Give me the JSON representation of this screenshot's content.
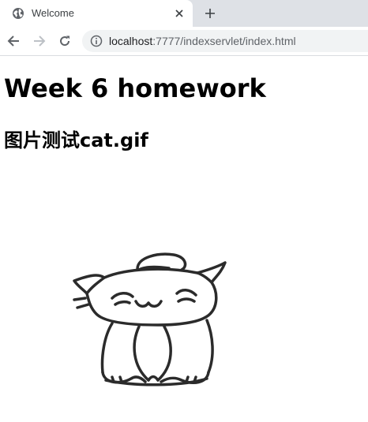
{
  "browser": {
    "tab_title": "Welcome",
    "url_host": "localhost",
    "url_rest": ":7777/indexservlet/index.html",
    "accent": "#5f6368"
  },
  "page": {
    "heading": "Week 6 homework",
    "subheading": "图片测试cat.gif"
  },
  "image": {
    "icon": "cat-doodle-image"
  }
}
